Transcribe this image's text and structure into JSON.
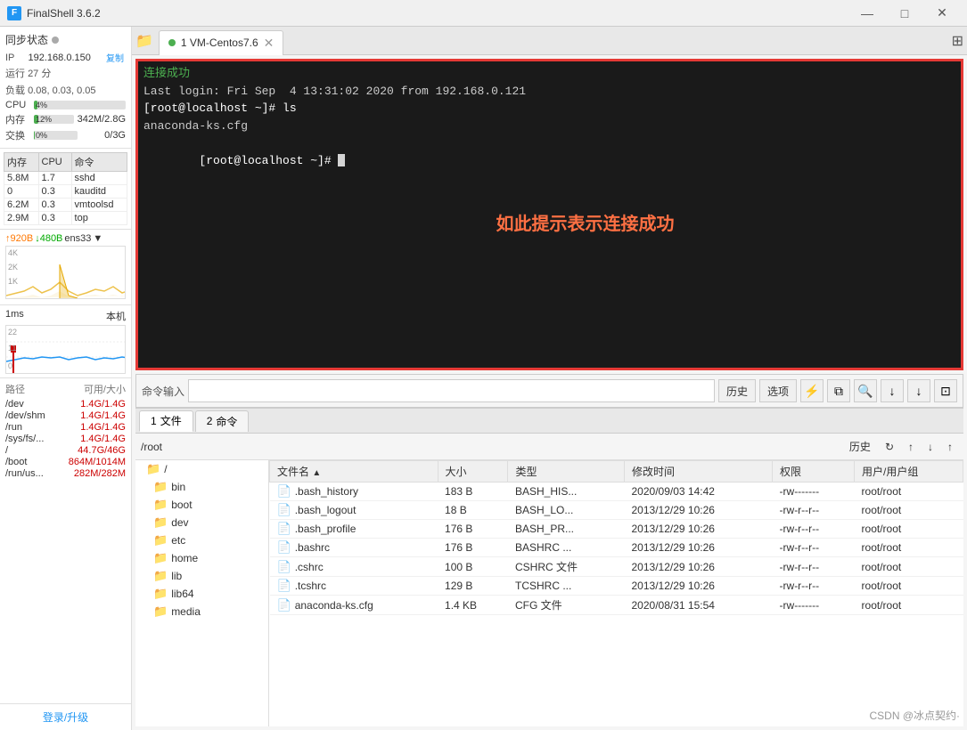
{
  "titlebar": {
    "app_name": "FinalShell 3.6.2",
    "min_btn": "—",
    "max_btn": "□",
    "close_btn": "✕"
  },
  "left_panel": {
    "sync_title": "同步状态",
    "ip_label": "IP",
    "ip_value": "192.168.0.150",
    "copy_label": "复制",
    "run_label": "运行",
    "run_value": "27 分",
    "load_label": "负载",
    "load_value": "0.08, 0.03, 0.05",
    "cpu_label": "CPU",
    "cpu_percent": "4%",
    "cpu_bar": 4,
    "mem_label": "内存",
    "mem_percent": "12%",
    "mem_detail": "342M/2.8G",
    "mem_bar": 12,
    "swap_label": "交换",
    "swap_percent": "0%",
    "swap_detail": "0/3G",
    "swap_bar": 0,
    "proc_table_headers": [
      "内存",
      "CPU",
      "命令"
    ],
    "processes": [
      {
        "mem": "5.8M",
        "cpu": "1.7",
        "cmd": "sshd"
      },
      {
        "mem": "0",
        "cpu": "0.3",
        "cmd": "kauditd"
      },
      {
        "mem": "6.2M",
        "cpu": "0.3",
        "cmd": "vmtoolsd"
      },
      {
        "mem": "2.9M",
        "cpu": "0.3",
        "cmd": "top"
      }
    ],
    "net_up": "↑920B",
    "net_down": "↓480B",
    "net_interface": "ens33",
    "net_labels": [
      "4K",
      "2K",
      "1K"
    ],
    "lat_header_left": "1ms",
    "lat_header_right": "本机",
    "lat_labels": [
      "22",
      "11",
      "0"
    ],
    "disk_header": [
      "路径",
      "可用/大小"
    ],
    "disks": [
      {
        "path": "/dev",
        "usage": "1.4G/1.4G"
      },
      {
        "path": "/dev/shm",
        "usage": "1.4G/1.4G"
      },
      {
        "path": "/run",
        "usage": "1.4G/1.4G"
      },
      {
        "path": "/sys/fs/...",
        "usage": "1.4G/1.4G"
      },
      {
        "path": "/",
        "usage": "44.7G/46G"
      },
      {
        "path": "/boot",
        "usage": "864M/1014M"
      },
      {
        "path": "/run/us...",
        "usage": "282M/282M"
      }
    ],
    "login_label": "登录/升级"
  },
  "tab_bar": {
    "folder_icon": "📁",
    "tab_label": "1 VM-Centos7.6",
    "grid_icon": "⊞"
  },
  "terminal": {
    "line1": "连接成功",
    "line2": "Last login: Fri Sep  4 13:31:02 2020 from 192.168.0.121",
    "line3": "[root@localhost ~]# ls",
    "line4": "anaconda-ks.cfg",
    "line5": "[root@localhost ~]# ",
    "annotation": "如此提示表示连接成功"
  },
  "cmd_bar": {
    "label": "命令输入",
    "history_btn": "历史",
    "options_btn": "选项",
    "lightning_icon": "⚡",
    "copy_icon": "⧉",
    "search_icon": "🔍",
    "down_icon": "↓",
    "down2_icon": "↓",
    "fullscreen_icon": "⊡"
  },
  "file_manager": {
    "tabs": [
      {
        "num": "1",
        "label": "文件"
      },
      {
        "num": "2",
        "label": "命令"
      }
    ],
    "toolbar": {
      "path": "/root",
      "history_btn": "历史",
      "refresh_icon": "↻",
      "up_icon": "↑",
      "download_icon": "↓",
      "upload_icon": "↑"
    },
    "tree": [
      {
        "name": "/",
        "level": 0
      },
      {
        "name": "bin",
        "level": 1
      },
      {
        "name": "boot",
        "level": 1
      },
      {
        "name": "dev",
        "level": 1
      },
      {
        "name": "etc",
        "level": 1
      },
      {
        "name": "home",
        "level": 1
      },
      {
        "name": "lib",
        "level": 1
      },
      {
        "name": "lib64",
        "level": 1
      },
      {
        "name": "media",
        "level": 1
      }
    ],
    "file_headers": [
      "文件名 ▲",
      "大小",
      "类型",
      "修改时间",
      "权限",
      "用户/用户组"
    ],
    "files": [
      {
        "name": ".bash_history",
        "size": "183 B",
        "type": "BASH_HIS...",
        "modified": "2020/09/03 14:42",
        "perms": "-rw-------",
        "owner": "root/root"
      },
      {
        "name": ".bash_logout",
        "size": "18 B",
        "type": "BASH_LO...",
        "modified": "2013/12/29 10:26",
        "perms": "-rw-r--r--",
        "owner": "root/root"
      },
      {
        "name": ".bash_profile",
        "size": "176 B",
        "type": "BASH_PR...",
        "modified": "2013/12/29 10:26",
        "perms": "-rw-r--r--",
        "owner": "root/root"
      },
      {
        "name": ".bashrc",
        "size": "176 B",
        "type": "BASHRC ...",
        "modified": "2013/12/29 10:26",
        "perms": "-rw-r--r--",
        "owner": "root/root"
      },
      {
        "name": ".cshrc",
        "size": "100 B",
        "type": "CSHRC 文件",
        "modified": "2013/12/29 10:26",
        "perms": "-rw-r--r--",
        "owner": "root/root"
      },
      {
        "name": ".tcshrc",
        "size": "129 B",
        "type": "TCSHRC ...",
        "modified": "2013/12/29 10:26",
        "perms": "-rw-r--r--",
        "owner": "root/root"
      },
      {
        "name": "anaconda-ks.cfg",
        "size": "1.4 KB",
        "type": "CFG 文件",
        "modified": "2020/08/31 15:54",
        "perms": "-rw-------",
        "owner": "root/root"
      }
    ]
  },
  "watermark": "CSDN @冰点契约·"
}
